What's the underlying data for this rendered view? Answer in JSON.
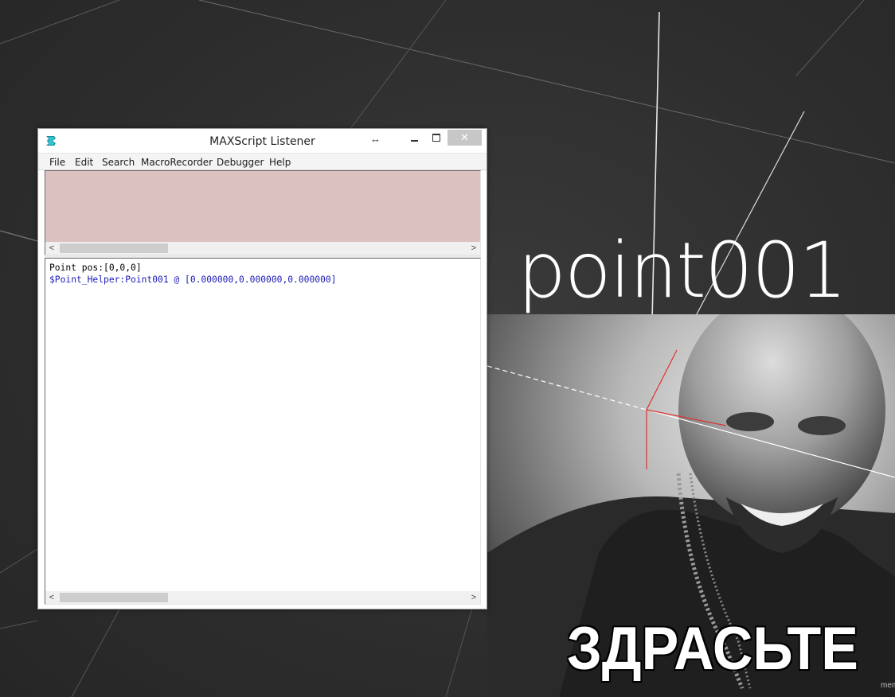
{
  "window": {
    "title": "MAXScript Listener",
    "resize_icon": "↔",
    "close_glyph": "✕"
  },
  "menu": {
    "file": "File",
    "edit": "Edit",
    "search": "Search",
    "macrorecorder": "MacroRecorder",
    "debugger": "Debugger",
    "help": "Help"
  },
  "scrollbars": {
    "left_arrow": "<",
    "right_arrow": ">"
  },
  "output": {
    "line1": "Point pos:[0,0,0]",
    "line2": "$Point_Helper:Point001 @ [0.000000,0.000000,0.000000]"
  },
  "colors": {
    "macro_pane_bg": "#dcc1c1",
    "input_text": "#000000",
    "result_text": "#1b1bb8"
  },
  "meme": {
    "title": "point001",
    "caption": "ЗДРАСЬТЕ",
    "watermark": "mem"
  },
  "icons": [
    "3dsmax-app-icon",
    "resize-icon",
    "minimize-icon",
    "maximize-icon",
    "close-icon"
  ]
}
